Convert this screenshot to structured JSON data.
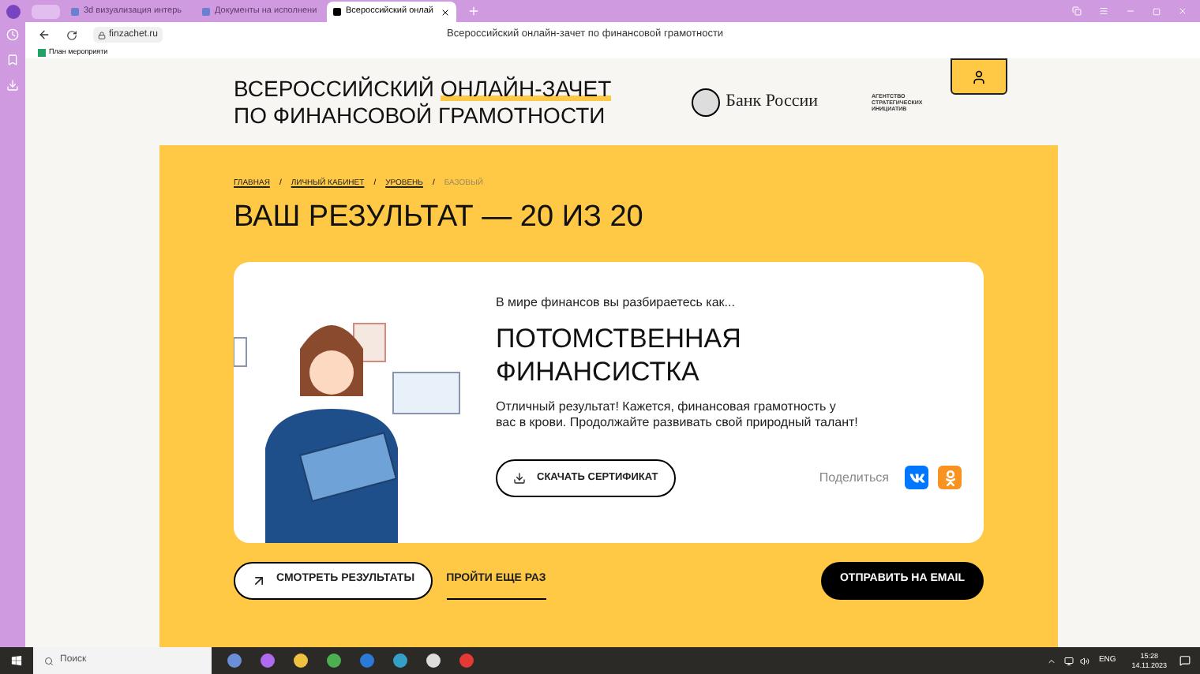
{
  "browser": {
    "tabs": [
      {
        "title": "3d визуализация интерь",
        "selected": false
      },
      {
        "title": "Документы на исполнени",
        "selected": false
      },
      {
        "title": "Всероссийский онлай",
        "selected": true
      }
    ],
    "address": "finzachet.ru",
    "page_title": "Всероссийский онлайн-зачет по финансовой грамотности",
    "bookmark": "План мероприяти"
  },
  "header": {
    "title_start": "ВСЕРОССИЙСКИЙ ",
    "title_highlight": "ОНЛАЙН-ЗАЧЕТ",
    "title_end": "ПО ФИНАНСОВОЙ ГРАМОТНОСТИ",
    "bank": "Банк России",
    "agency": "АГЕНТСТВО СТРАТЕГИЧЕСКИХ ИНИЦИАТИВ"
  },
  "breadcrumb_separator": "/",
  "breadcrumbs": [
    {
      "label": "ГЛАВНАЯ",
      "current": false
    },
    {
      "label": "ЛИЧНЫЙ КАБИНЕТ",
      "current": false
    },
    {
      "label": "УРОВЕНЬ",
      "current": false
    },
    {
      "label": "БАЗОВЫЙ",
      "current": true
    }
  ],
  "heading": "ВАШ РЕЗУЛЬТАТ — 20 ИЗ 20",
  "card": {
    "intro": "В мире финансов вы разбираетесь как...",
    "title": "ПОТОМСТВЕННАЯ ФИНАНСИСТКА",
    "text": "Отличный результат! Кажется, финансовая грамотность у вас в крови. Продолжайте развивать свой природный талант!",
    "download": "СКАЧАТЬ СЕРТИФИКАТ",
    "share_label": "Поделиться",
    "share": [
      {
        "kind": "vk"
      },
      {
        "kind": "ok"
      }
    ]
  },
  "actions": [
    {
      "kind": "outline",
      "label": "СМОТРЕТЬ РЕЗУЛЬТАТЫ"
    },
    {
      "kind": "link",
      "label": "ПРОЙТИ ЕЩЕ РАЗ"
    },
    {
      "kind": "spacer"
    },
    {
      "kind": "filled",
      "label": "ОТПРАВИТЬ НА EMAIL"
    }
  ],
  "taskbar": {
    "search_placeholder": "Поиск",
    "language": "ENG",
    "time": "15:28",
    "date": "14.11.2023"
  }
}
